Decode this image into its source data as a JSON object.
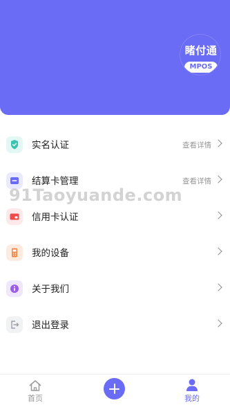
{
  "header": {
    "logo_text": "睹付通",
    "logo_badge": "MPOS"
  },
  "menu": {
    "items": [
      {
        "label": "实名认证",
        "detail": "查看详情",
        "icon": "shield-check-icon"
      },
      {
        "label": "结算卡管理",
        "detail": "查看详情",
        "icon": "bank-card-icon"
      },
      {
        "label": "信用卡认证",
        "detail": "",
        "icon": "credit-card-icon"
      },
      {
        "label": "我的设备",
        "detail": "",
        "icon": "pos-device-icon"
      },
      {
        "label": "关于我们",
        "detail": "",
        "icon": "info-icon"
      },
      {
        "label": "退出登录",
        "detail": "",
        "icon": "logout-icon"
      }
    ]
  },
  "watermark": "91Taoyuande.com",
  "tabbar": {
    "home_label": "首页",
    "add_icon": "plus-icon",
    "mine_label": "我的"
  },
  "colors": {
    "primary": "#6b6cf5",
    "inactive_tab": "#999999"
  }
}
